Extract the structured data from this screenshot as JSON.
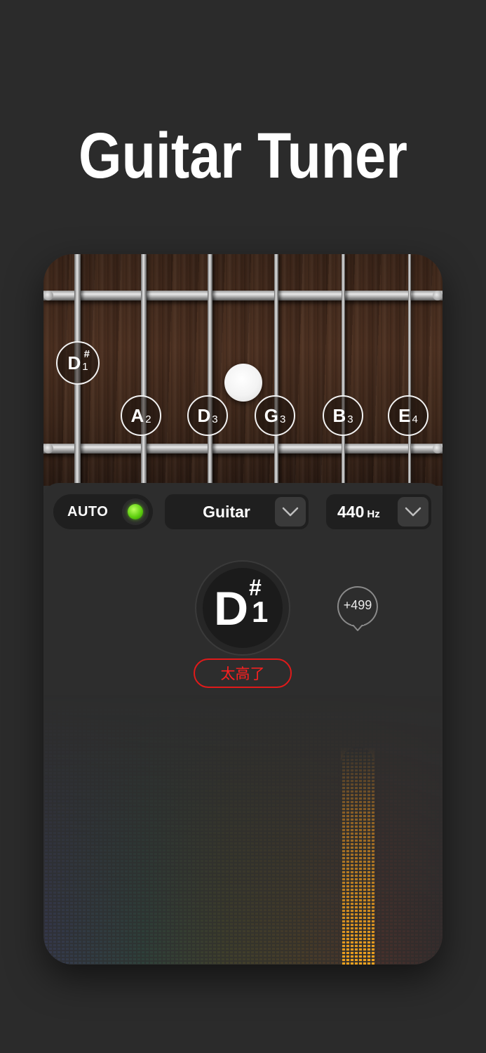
{
  "headline": "Guitar Tuner",
  "strings": [
    {
      "note": "A",
      "octave": "2",
      "sharp": ""
    },
    {
      "note": "D",
      "octave": "3",
      "sharp": ""
    },
    {
      "note": "G",
      "octave": "3",
      "sharp": ""
    },
    {
      "note": "B",
      "octave": "3",
      "sharp": ""
    },
    {
      "note": "E",
      "octave": "4",
      "sharp": ""
    }
  ],
  "detected_marker": {
    "note": "D",
    "sharp": "#",
    "octave": "1"
  },
  "controls": {
    "auto_label": "AUTO",
    "auto_enabled": true,
    "instrument": "Guitar",
    "reference_hz": "440",
    "reference_unit": "Hz"
  },
  "current_note": {
    "note": "D",
    "sharp": "#",
    "octave": "1"
  },
  "status_text": "太高了",
  "cents_offset": "+499",
  "colors": {
    "background": "#2b2b2b",
    "status_red": "#e01a1a",
    "auto_led_green": "#5fcf10",
    "spectrum_peak": "#f2a21e"
  },
  "icons": {
    "instrument_dropdown": "chevron-down-icon",
    "hz_dropdown": "chevron-down-icon",
    "auto_led": "led-indicator-icon",
    "cents": "speech-bubble-icon"
  }
}
